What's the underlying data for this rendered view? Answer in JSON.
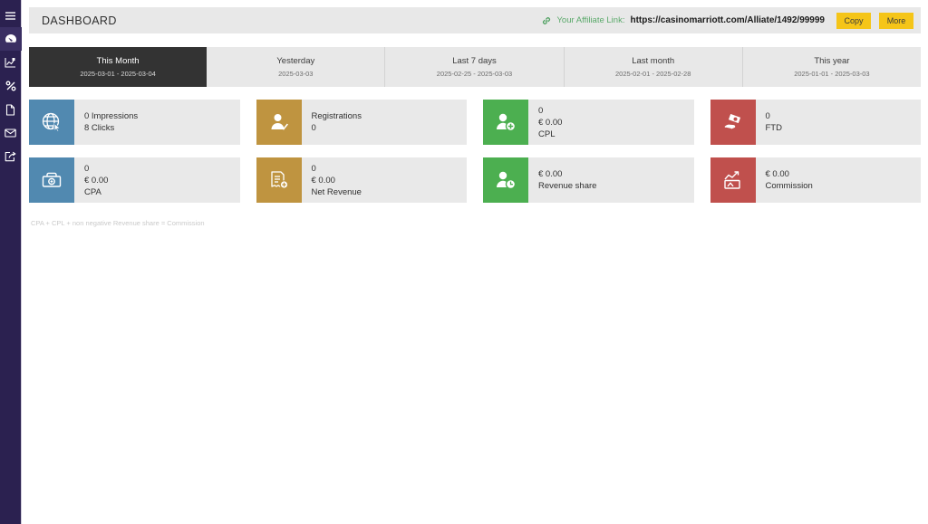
{
  "sidebar": {
    "items": [
      {
        "name": "menu-toggle",
        "icon": "hamburger-icon",
        "active": false
      },
      {
        "name": "dashboard",
        "icon": "gauge-icon",
        "active": true
      },
      {
        "name": "statistics",
        "icon": "chart-icon",
        "active": false
      },
      {
        "name": "commissions",
        "icon": "percent-icon",
        "active": false
      },
      {
        "name": "documents",
        "icon": "file-icon",
        "active": false
      },
      {
        "name": "messages",
        "icon": "envelope-icon",
        "active": false
      },
      {
        "name": "promotions",
        "icon": "share-export-icon",
        "active": false
      }
    ]
  },
  "header": {
    "title": "DASHBOARD",
    "affiliate_label": "Your Affiliate Link:",
    "affiliate_url": "https://casinomarriott.com/Alliate/1492/99999",
    "copy_label": "Copy",
    "more_label": "More"
  },
  "tabs": [
    {
      "label": "This Month",
      "range": "2025-03-01 - 2025-03-04",
      "active": true
    },
    {
      "label": "Yesterday",
      "range": "2025-03-03",
      "active": false
    },
    {
      "label": "Last 7 days",
      "range": "2025-02-25 - 2025-03-03",
      "active": false
    },
    {
      "label": "Last month",
      "range": "2025-02-01 - 2025-02-28",
      "active": false
    },
    {
      "label": "This year",
      "range": "2025-01-01 - 2025-03-03",
      "active": false
    }
  ],
  "cards": {
    "row1": [
      {
        "name": "impressions-clicks",
        "icon": "globe-cursor-icon",
        "color": "#5189b0",
        "lines": [
          "0 Impressions",
          "8 Clicks"
        ]
      },
      {
        "name": "registrations",
        "icon": "user-check-icon",
        "color": "#bf9440",
        "lines": [
          "Registrations",
          "0"
        ]
      },
      {
        "name": "cpl",
        "icon": "user-plus-icon",
        "color": "#4caf50",
        "lines": [
          "0",
          "€ 0.00",
          "CPL"
        ]
      },
      {
        "name": "ftd",
        "icon": "cash-hand-icon",
        "color": "#c0504d",
        "lines": [
          "0",
          "FTD"
        ]
      }
    ],
    "row2": [
      {
        "name": "cpa",
        "icon": "money-bag-icon",
        "color": "#5189b0",
        "lines": [
          "0",
          "€ 0.00",
          "CPA"
        ]
      },
      {
        "name": "net-revenue",
        "icon": "invoice-plus-icon",
        "color": "#bf9440",
        "lines": [
          "0",
          "€ 0.00",
          "Net Revenue"
        ]
      },
      {
        "name": "revenue-share",
        "icon": "user-clock-icon",
        "color": "#4caf50",
        "lines": [
          "€ 0.00",
          "Revenue share"
        ]
      },
      {
        "name": "commission",
        "icon": "growth-chart-icon",
        "color": "#c0504d",
        "lines": [
          "€ 0.00",
          "Commission"
        ]
      }
    ]
  },
  "footnote": "CPA + CPL + non negative Revenue share = Commission"
}
